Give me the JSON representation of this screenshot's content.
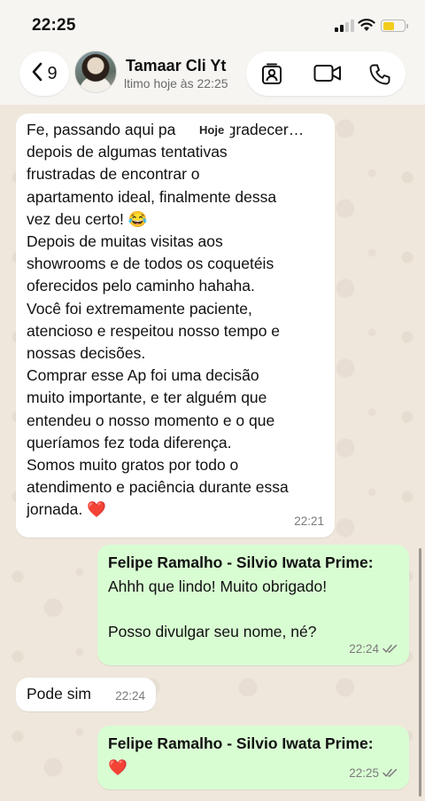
{
  "status_bar": {
    "time": "22:25",
    "battery_level": 0.55
  },
  "header": {
    "back_count": "9",
    "contact_name": "Tamaar Cli Yt",
    "last_seen": "ltimo hoje às 22:25"
  },
  "date_chip": "Hoje",
  "messages": [
    {
      "direction": "in",
      "text": "Fe, passando aqui pa          agradecer…\ndepois de algumas tentativas\nfrustradas de encontrar o\napartamento ideal, finalmente dessa\nvez deu certo! 😂\nDepois de muitas visitas aos\nshowrooms e de todos os coquetéis\noferecidos pelo caminho hahaha.\nVocê foi extremamente paciente,\natencioso e respeitou nosso tempo e\nnossas decisões.\nComprar esse Ap foi uma decisão\nmuito importante, e ter alguém que\nentendeu o nosso momento e o que\nqueríamos fez toda diferença.\nSomos muito gratos por todo o\natendimento e paciência durante essa\njornada. ❤️",
      "time": "22:21"
    },
    {
      "direction": "out",
      "sender": "Felipe Ramalho - Silvio Iwata Prime:",
      "text": "Ahhh que lindo! Muito obrigado!\n\nPosso divulgar seu nome, né?",
      "time": "22:24",
      "status": "read"
    },
    {
      "direction": "in",
      "text": "Pode sim",
      "time": "22:24"
    },
    {
      "direction": "out",
      "sender": "Felipe Ramalho - Silvio Iwata Prime:",
      "text": "❤️",
      "time": "22:25",
      "status": "read"
    }
  ],
  "icons": {
    "back": "chevron-left-icon",
    "contact_card": "contact-card-icon",
    "video_call": "video-camera-icon",
    "voice_call": "phone-icon",
    "read_receipt": "double-check-icon"
  },
  "colors": {
    "incoming_bubble": "#ffffff",
    "outgoing_bubble": "#d9fdd3",
    "wallpaper": "#efe7dc",
    "read_tick": "#7b7b7b"
  }
}
